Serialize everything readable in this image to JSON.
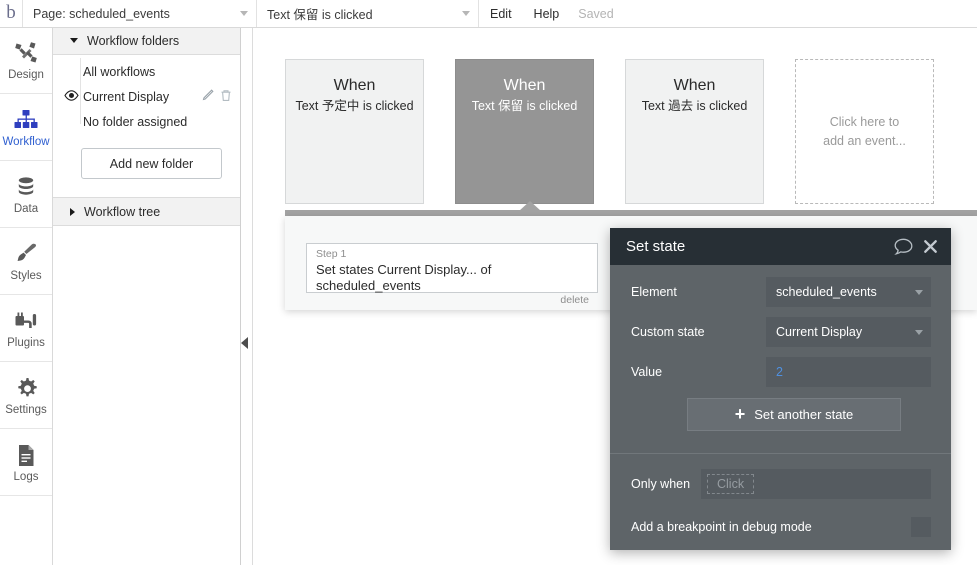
{
  "topbar": {
    "logo": "b",
    "page_select": {
      "label": "Page: scheduled_events"
    },
    "event_select": {
      "label": "Text 保留 is clicked"
    },
    "edit": "Edit",
    "help": "Help",
    "status": "Saved"
  },
  "rail": {
    "items": [
      {
        "label": "Design",
        "icon": "design-icon",
        "active": false
      },
      {
        "label": "Workflow",
        "icon": "workflow-icon",
        "active": true
      },
      {
        "label": "Data",
        "icon": "data-icon",
        "active": false
      },
      {
        "label": "Styles",
        "icon": "styles-icon",
        "active": false
      },
      {
        "label": "Plugins",
        "icon": "plugins-icon",
        "active": false
      },
      {
        "label": "Settings",
        "icon": "settings-icon",
        "active": false
      },
      {
        "label": "Logs",
        "icon": "logs-icon",
        "active": false
      }
    ]
  },
  "folders": {
    "header": "Workflow folders",
    "items": [
      {
        "label": "All workflows",
        "has_eye": false,
        "has_actions": false
      },
      {
        "label": "Current Display",
        "has_eye": true,
        "has_actions": true
      },
      {
        "label": "No folder assigned",
        "has_eye": false,
        "has_actions": false
      }
    ],
    "add_button": "Add new folder",
    "tree_header": "Workflow tree"
  },
  "canvas": {
    "events": [
      {
        "when": "When",
        "subtitle": "Text 予定中 is clicked",
        "selected": false,
        "placeholder": false
      },
      {
        "when": "When",
        "subtitle": "Text 保留 is clicked",
        "selected": true,
        "placeholder": false
      },
      {
        "when": "When",
        "subtitle": "Text 過去 is clicked",
        "selected": false,
        "placeholder": false
      },
      {
        "placeholder": true,
        "text": "Click here to add an event..."
      }
    ],
    "step": {
      "number": "Step 1",
      "title": "Set states Current Display... of scheduled_events",
      "delete": "delete",
      "add_glyph": "+"
    }
  },
  "setstate": {
    "title": "Set state",
    "rows": [
      {
        "label": "Element",
        "value": "scheduled_events",
        "type": "dropdown"
      },
      {
        "label": "Custom state",
        "value": "Current Display",
        "type": "dropdown"
      },
      {
        "label": "Value",
        "value": "2",
        "type": "number"
      }
    ],
    "another_label": "Set another state",
    "only_when_label": "Only when",
    "only_when_placeholder": "Click",
    "breakpoint_label": "Add a breakpoint in debug mode"
  },
  "colors": {
    "accent_blue": "#2f5fd0",
    "value_blue": "#4f90e0",
    "panel_bg": "#5e6468",
    "panel_header": "#272f35",
    "selected_card": "#959595"
  }
}
